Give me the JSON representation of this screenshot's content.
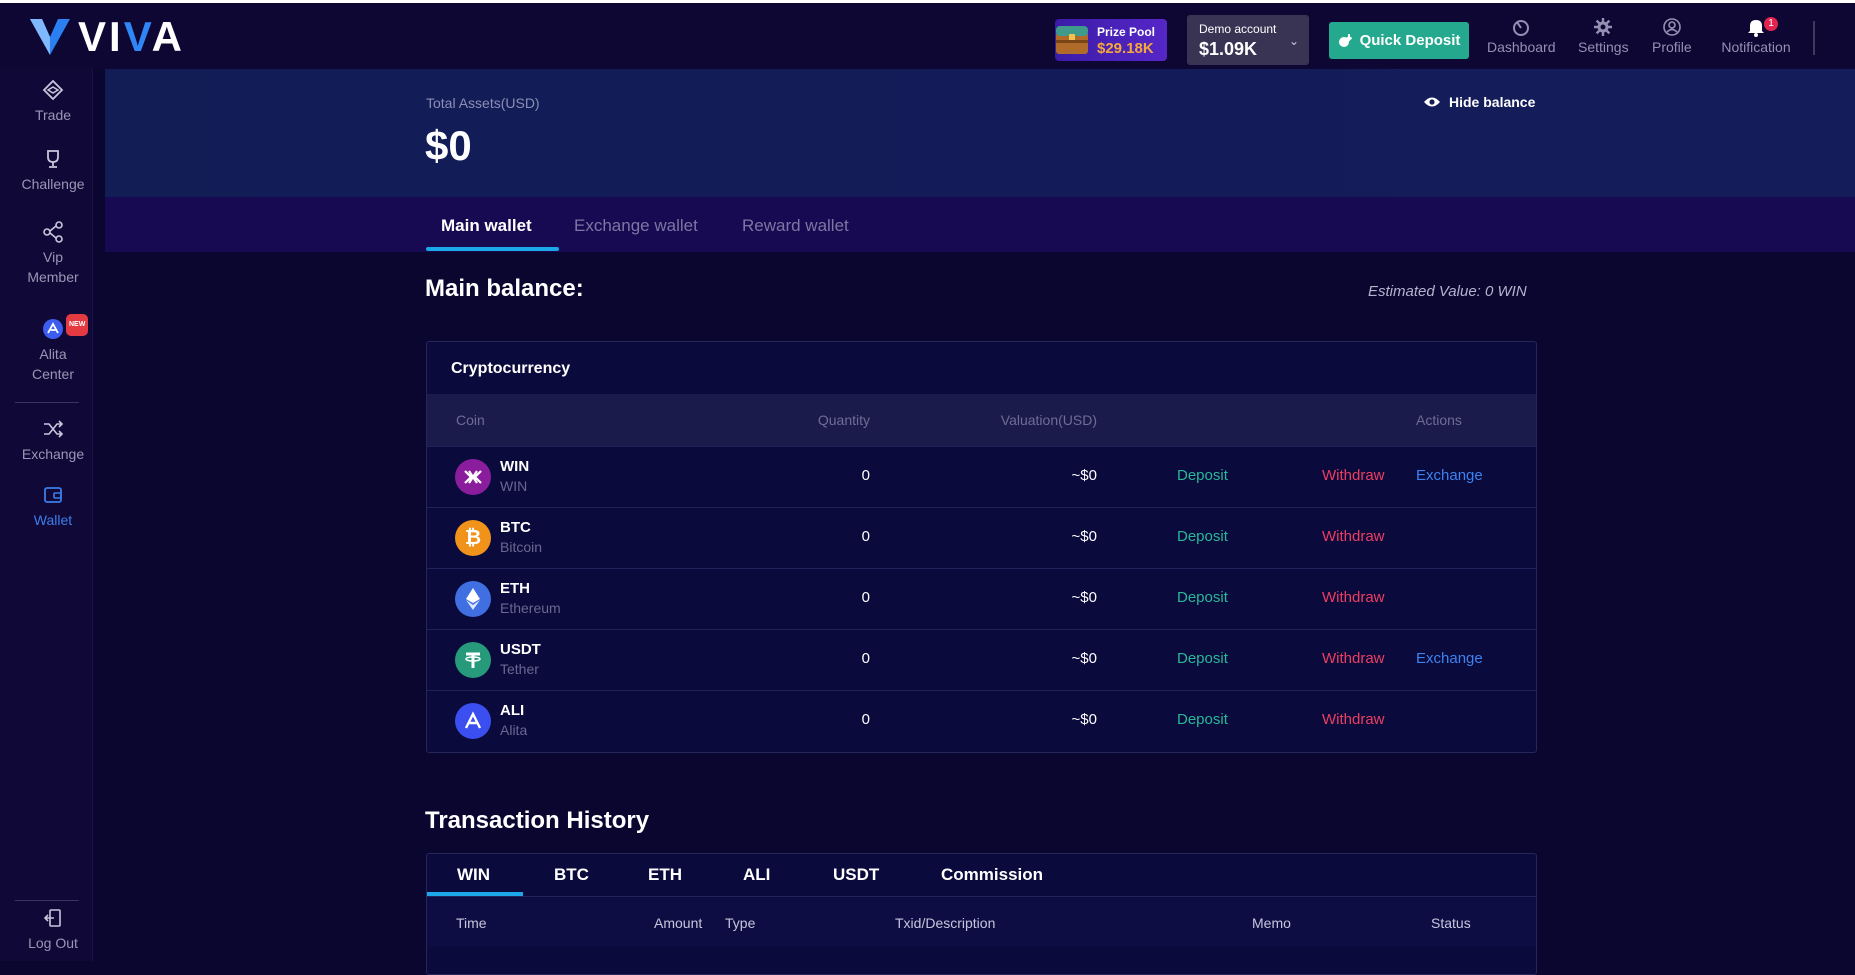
{
  "brand": {
    "name_parts": [
      "V",
      "I",
      "V",
      "A"
    ]
  },
  "header": {
    "prize_pool_label": "Prize Pool",
    "prize_pool_value": "$29.18K",
    "account_label": "Demo account",
    "account_value": "$1.09K",
    "quick_deposit": "Quick Deposit",
    "nav": [
      {
        "label": "Dashboard",
        "icon": "dashboard-icon"
      },
      {
        "label": "Settings",
        "icon": "gear-icon"
      },
      {
        "label": "Profile",
        "icon": "profile-icon"
      },
      {
        "label": "Notification",
        "icon": "bell-icon",
        "badge": "1"
      }
    ]
  },
  "sidebar": {
    "items": [
      {
        "label": "Trade",
        "icon": "trade-icon"
      },
      {
        "label": "Challenge",
        "icon": "trophy-icon"
      },
      {
        "label": "Vip Member",
        "icon": "share-icon"
      },
      {
        "label": "Alita Center",
        "icon": "alita-icon",
        "badge": "NEW"
      },
      {
        "label": "Exchange",
        "icon": "shuffle-icon"
      },
      {
        "label": "Wallet",
        "icon": "wallet-icon",
        "active": true
      }
    ],
    "logout": "Log Out"
  },
  "assets": {
    "label": "Total Assets(USD)",
    "value": "$0",
    "hide_balance": "Hide balance"
  },
  "wallet_tabs": [
    "Main wallet",
    "Exchange wallet",
    "Reward wallet"
  ],
  "main_balance": {
    "title": "Main balance:",
    "estimated": "Estimated Value: 0 WIN"
  },
  "crypto": {
    "title": "Cryptocurrency",
    "columns": [
      "Coin",
      "Quantity",
      "Valuation(USD)",
      "Actions"
    ],
    "rows": [
      {
        "symbol": "WIN",
        "name": "WIN",
        "quantity": "0",
        "valuation": "~$0",
        "deposit": "Deposit",
        "withdraw": "Withdraw",
        "exchange": "Exchange",
        "color": "#8a1d9c"
      },
      {
        "symbol": "BTC",
        "name": "Bitcoin",
        "quantity": "0",
        "valuation": "~$0",
        "deposit": "Deposit",
        "withdraw": "Withdraw",
        "exchange": "",
        "color": "#f1931a"
      },
      {
        "symbol": "ETH",
        "name": "Ethereum",
        "quantity": "0",
        "valuation": "~$0",
        "deposit": "Deposit",
        "withdraw": "Withdraw",
        "exchange": "",
        "color": "#3f6fe0"
      },
      {
        "symbol": "USDT",
        "name": "Tether",
        "quantity": "0",
        "valuation": "~$0",
        "deposit": "Deposit",
        "withdraw": "Withdraw",
        "exchange": "Exchange",
        "color": "#269a7b"
      },
      {
        "symbol": "ALI",
        "name": "Alita",
        "quantity": "0",
        "valuation": "~$0",
        "deposit": "Deposit",
        "withdraw": "Withdraw",
        "exchange": "",
        "color": "#3b4ef0"
      }
    ]
  },
  "transactions": {
    "title": "Transaction History",
    "tabs": [
      "WIN",
      "BTC",
      "ETH",
      "ALI",
      "USDT",
      "Commission"
    ],
    "columns": [
      "Time",
      "Amount",
      "Type",
      "Txid/Description",
      "Memo",
      "Status"
    ]
  }
}
